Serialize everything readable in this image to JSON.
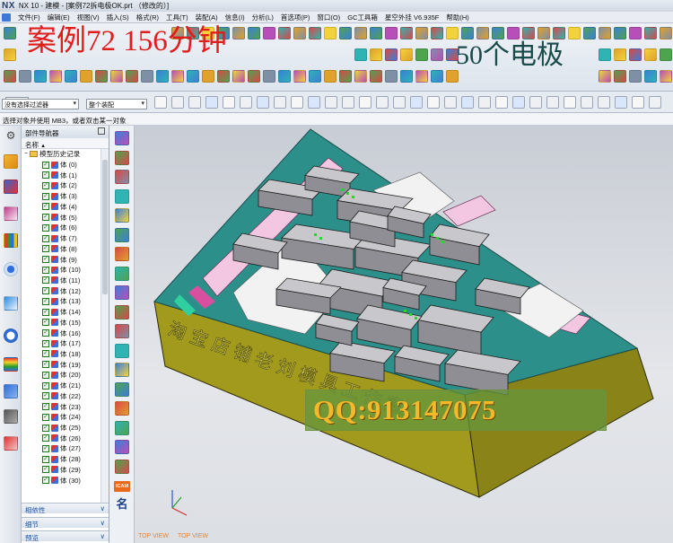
{
  "titlebar": {
    "logo": "NX",
    "title": "NX 10 - 建模 - [案例72拆电极OK.prt （修改的）]"
  },
  "menu": {
    "items": [
      "文件(F)",
      "编辑(E)",
      "视图(V)",
      "插入(S)",
      "格式(R)",
      "工具(T)",
      "装配(A)",
      "信息(I)",
      "分析(L)",
      "首选项(P)",
      "窗口(O)",
      "GC工具箱",
      "星空外挂 V6.935F",
      "帮助(H)"
    ]
  },
  "overlay": {
    "case_title": "案例72   156分钟",
    "electrode_title": "50个电极"
  },
  "filterbar": {
    "zoom_value": "240",
    "selection_filter": "没有选择过滤器",
    "assembly_scope": "整个装配"
  },
  "cue_line": "选择对象并使用 MB3，或者双击某一对象",
  "navigator": {
    "title": "部件导航器",
    "column_name": "名称",
    "root_label": "模型历史记录",
    "bodies": [
      "体 (0)",
      "体 (1)",
      "体 (2)",
      "体 (3)",
      "体 (4)",
      "体 (5)",
      "体 (6)",
      "体 (7)",
      "体 (8)",
      "体 (9)",
      "体 (10)",
      "体 (11)",
      "体 (12)",
      "体 (13)",
      "体 (14)",
      "体 (15)",
      "体 (16)",
      "体 (17)",
      "体 (18)",
      "体 (19)",
      "体 (20)",
      "体 (21)",
      "体 (22)",
      "体 (23)",
      "体 (24)",
      "体 (25)",
      "体 (26)",
      "体 (27)",
      "体 (28)",
      "体 (29)",
      "体 (30)"
    ],
    "panels": [
      "相依性",
      "细节",
      "预览"
    ]
  },
  "vtool": {
    "icam_label": "ICAM",
    "ming_label": "名"
  },
  "graphics": {
    "engraving": "淘 宝 店 铺   老 刘 模 具 工 作 室",
    "watermark": "QQ:913147075",
    "view_label_1": "TOP VIEW",
    "view_label_2": "TOP VIEW"
  }
}
